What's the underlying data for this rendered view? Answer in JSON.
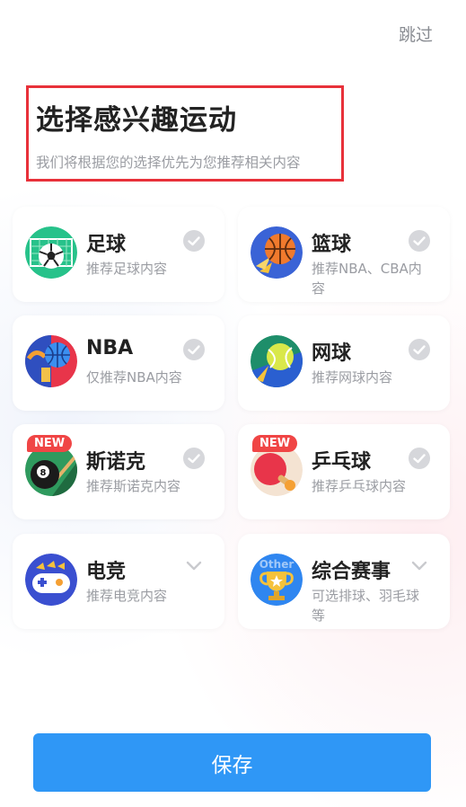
{
  "skip_label": "跳过",
  "header": {
    "title": "选择感兴趣运动",
    "subtitle": "我们将根据您的选择优先为您推荐相关内容"
  },
  "sports": [
    {
      "name": "足球",
      "desc": "推荐足球内容",
      "icon": "soccer-ball-icon",
      "action": "check"
    },
    {
      "name": "篮球",
      "desc": "推荐NBA、CBA内容",
      "icon": "basketball-icon",
      "action": "check"
    },
    {
      "name": "NBA",
      "desc": "仅推荐NBA内容",
      "icon": "nba-icon",
      "action": "check"
    },
    {
      "name": "网球",
      "desc": "推荐网球内容",
      "icon": "tennis-ball-icon",
      "action": "check"
    },
    {
      "name": "斯诺克",
      "desc": "推荐斯诺克内容",
      "icon": "eight-ball-icon",
      "action": "check",
      "badge": "NEW"
    },
    {
      "name": "乒乓球",
      "desc": "推荐乒乓球内容",
      "icon": "ping-pong-icon",
      "action": "check",
      "badge": "NEW"
    },
    {
      "name": "电竞",
      "desc": "推荐电竞内容",
      "icon": "gamepad-icon",
      "action": "expand"
    },
    {
      "name": "综合赛事",
      "desc": "可选排球、羽毛球等",
      "icon": "trophy-icon",
      "action": "expand",
      "icon_text": "Other"
    }
  ],
  "save_label": "保存",
  "colors": {
    "accent": "#2f97f6",
    "highlight_border": "#e8313a",
    "badge": "#f04545",
    "check_gray": "#d6d7db"
  }
}
